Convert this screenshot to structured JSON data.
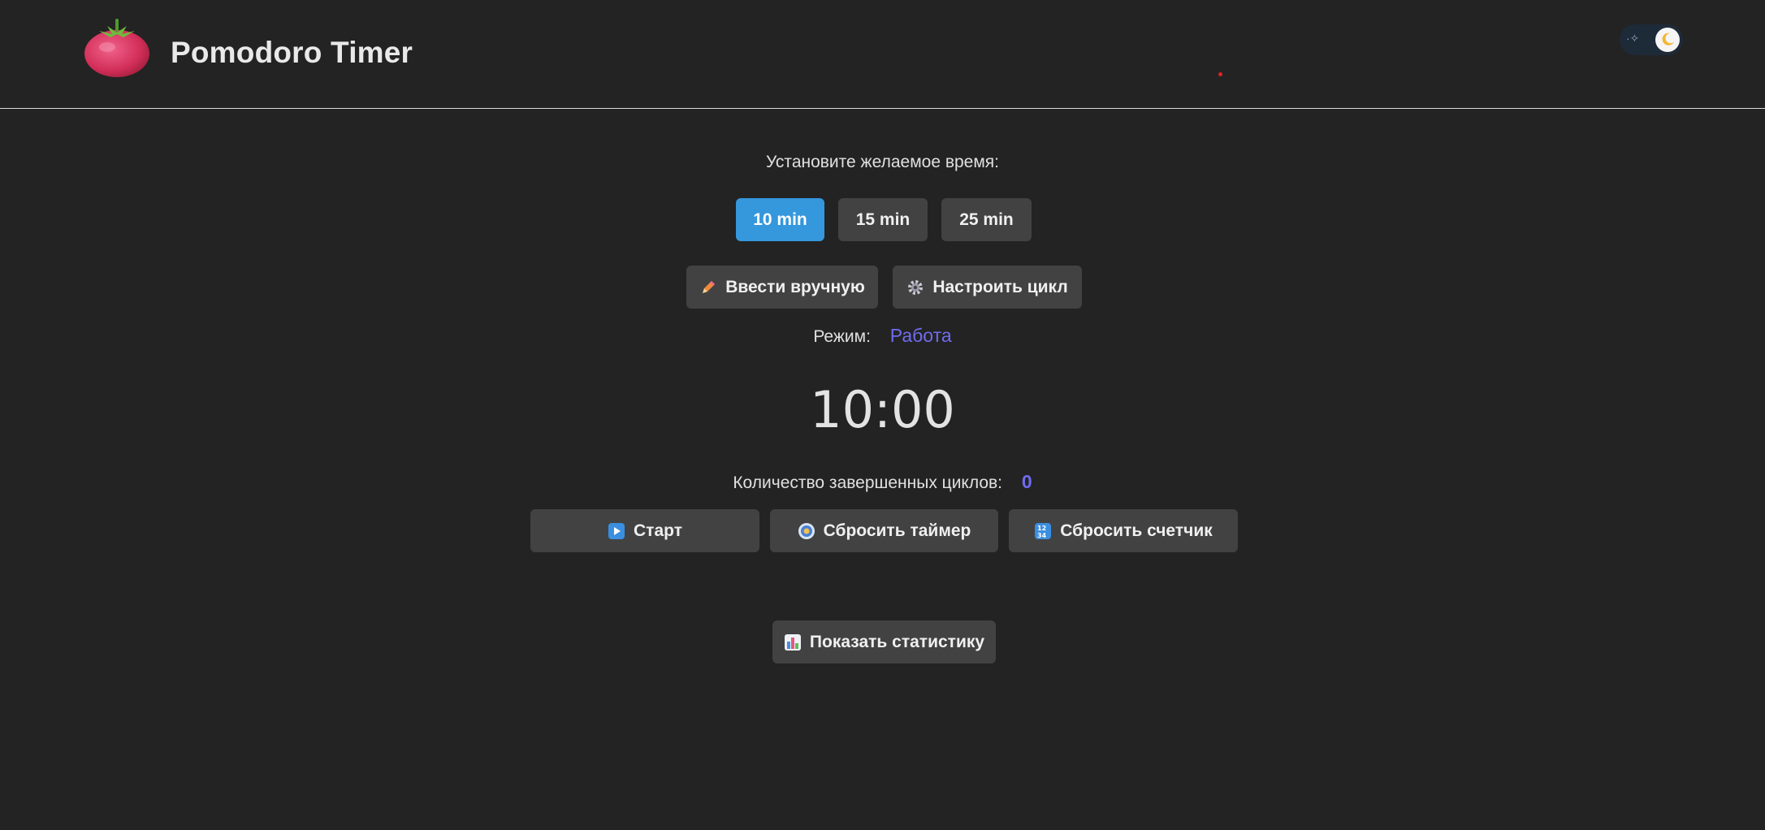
{
  "header": {
    "title": "Pomodoro Timer",
    "logo_icon": "tomato-icon",
    "theme_toggle_icon": "moon-icon"
  },
  "timer_setup": {
    "prompt": "Установите желаемое время:",
    "presets": [
      {
        "label": "10 min",
        "active": true
      },
      {
        "label": "15 min",
        "active": false
      },
      {
        "label": "25 min",
        "active": false
      }
    ],
    "manual_entry_label": "Ввести вручную",
    "configure_cycle_label": "Настроить цикл"
  },
  "mode": {
    "label": "Режим:",
    "value": "Работа"
  },
  "timer": {
    "display": "10:00"
  },
  "cycles": {
    "label": "Количество завершенных циклов:",
    "count": "0"
  },
  "controls": {
    "start_label": "Старт",
    "reset_timer_label": "Сбросить таймер",
    "reset_counter_label": "Сбросить счетчик"
  },
  "stats": {
    "show_label": "Показать статистику"
  },
  "colors": {
    "background": "#232323",
    "accent": "#3597dc",
    "highlight": "#6f6cf0",
    "button": "#424242"
  }
}
